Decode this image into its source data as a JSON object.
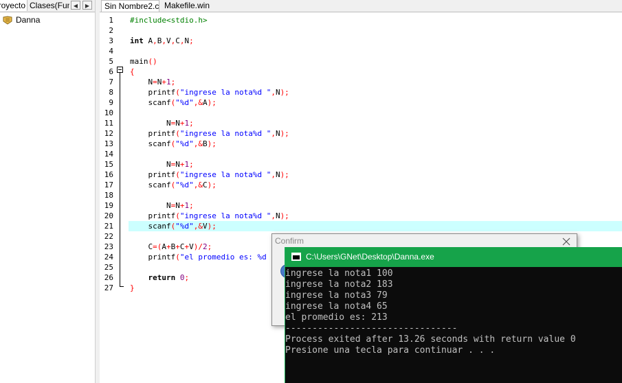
{
  "left_panel": {
    "tabs": [
      "royecto",
      "Clases(Fun"
    ],
    "project_name": "Danna"
  },
  "editor": {
    "tabs": [
      "Sin Nombre2.c",
      "Makefile.win"
    ],
    "highlight_line": 21,
    "lines": [
      [
        [
          "#include<stdio.h>",
          "pre"
        ]
      ],
      [],
      [
        [
          "int",
          "kw"
        ],
        [
          " A",
          ""
        ],
        [
          ",",
          "op"
        ],
        [
          "B",
          ""
        ],
        [
          ",",
          "op"
        ],
        [
          "V",
          ""
        ],
        [
          ",",
          "op"
        ],
        [
          "C",
          ""
        ],
        [
          ",",
          "op"
        ],
        [
          "N",
          ""
        ],
        [
          ";",
          "op"
        ]
      ],
      [],
      [
        [
          "main",
          "fn"
        ],
        [
          "()",
          "op"
        ]
      ],
      [
        [
          "{",
          "op"
        ]
      ],
      [
        [
          "    N",
          "plain"
        ],
        [
          "=",
          "op"
        ],
        [
          "N",
          "plain"
        ],
        [
          "+",
          "op"
        ],
        [
          "1",
          "num"
        ],
        [
          ";",
          "op"
        ]
      ],
      [
        [
          "    printf",
          "plain"
        ],
        [
          "(",
          "op"
        ],
        [
          "\"ingrese la nota%d \"",
          "str"
        ],
        [
          ",",
          "op"
        ],
        [
          "N",
          "plain"
        ],
        [
          ");",
          "op"
        ]
      ],
      [
        [
          "    scanf",
          "plain"
        ],
        [
          "(",
          "op"
        ],
        [
          "\"%d\"",
          "str"
        ],
        [
          ",&",
          "op"
        ],
        [
          "A",
          "plain"
        ],
        [
          ");",
          "op"
        ]
      ],
      [],
      [
        [
          "        N",
          "plain"
        ],
        [
          "=",
          "op"
        ],
        [
          "N",
          "plain"
        ],
        [
          "+",
          "op"
        ],
        [
          "1",
          "num"
        ],
        [
          ";",
          "op"
        ]
      ],
      [
        [
          "    printf",
          "plain"
        ],
        [
          "(",
          "op"
        ],
        [
          "\"ingrese la nota%d \"",
          "str"
        ],
        [
          ",",
          "op"
        ],
        [
          "N",
          "plain"
        ],
        [
          ");",
          "op"
        ]
      ],
      [
        [
          "    scanf",
          "plain"
        ],
        [
          "(",
          "op"
        ],
        [
          "\"%d\"",
          "str"
        ],
        [
          ",&",
          "op"
        ],
        [
          "B",
          "plain"
        ],
        [
          ");",
          "op"
        ]
      ],
      [],
      [
        [
          "        N",
          "plain"
        ],
        [
          "=",
          "op"
        ],
        [
          "N",
          "plain"
        ],
        [
          "+",
          "op"
        ],
        [
          "1",
          "num"
        ],
        [
          ";",
          "op"
        ]
      ],
      [
        [
          "    printf",
          "plain"
        ],
        [
          "(",
          "op"
        ],
        [
          "\"ingrese la nota%d \"",
          "str"
        ],
        [
          ",",
          "op"
        ],
        [
          "N",
          "plain"
        ],
        [
          ");",
          "op"
        ]
      ],
      [
        [
          "    scanf",
          "plain"
        ],
        [
          "(",
          "op"
        ],
        [
          "\"%d\"",
          "str"
        ],
        [
          ",&",
          "op"
        ],
        [
          "C",
          "plain"
        ],
        [
          ");",
          "op"
        ]
      ],
      [],
      [
        [
          "        N",
          "plain"
        ],
        [
          "=",
          "op"
        ],
        [
          "N",
          "plain"
        ],
        [
          "+",
          "op"
        ],
        [
          "1",
          "num"
        ],
        [
          ";",
          "op"
        ]
      ],
      [
        [
          "    printf",
          "plain"
        ],
        [
          "(",
          "op"
        ],
        [
          "\"ingrese la nota%d \"",
          "str"
        ],
        [
          ",",
          "op"
        ],
        [
          "N",
          "plain"
        ],
        [
          ");",
          "op"
        ]
      ],
      [
        [
          "    scanf",
          "plain"
        ],
        [
          "(",
          "op"
        ],
        [
          "\"%d\"",
          "str"
        ],
        [
          ",&",
          "op"
        ],
        [
          "V",
          "plain"
        ],
        [
          ");",
          "op"
        ]
      ],
      [],
      [
        [
          "    C",
          "plain"
        ],
        [
          "=(",
          "op"
        ],
        [
          "A",
          "plain"
        ],
        [
          "+",
          "op"
        ],
        [
          "B",
          "plain"
        ],
        [
          "+",
          "op"
        ],
        [
          "C",
          "plain"
        ],
        [
          "+",
          "op"
        ],
        [
          "V",
          "plain"
        ],
        [
          ")/",
          "op"
        ],
        [
          "2",
          "num"
        ],
        [
          ";",
          "op"
        ]
      ],
      [
        [
          "    printf",
          "plain"
        ],
        [
          "(",
          "op"
        ],
        [
          "\"el promedio es: %d",
          "str"
        ]
      ],
      [],
      [
        [
          "    ",
          "plain"
        ],
        [
          "return",
          "kw"
        ],
        [
          " ",
          "plain"
        ],
        [
          "0",
          "num"
        ],
        [
          ";",
          "op"
        ]
      ],
      [
        [
          "}",
          "op"
        ]
      ]
    ]
  },
  "confirm_dialog": {
    "title": "Confirm"
  },
  "console": {
    "title": "C:\\Users\\GNet\\Desktop\\Danna.exe",
    "output": [
      "ingrese la nota1 100",
      "ingrese la nota2 183",
      "ingrese la nota3 79",
      "ingrese la nota4 65",
      "el promedio es: 213",
      "--------------------------------",
      "Process exited after 13.26 seconds with return value 0",
      "Presione una tecla para continuar . . ."
    ]
  },
  "colors": {
    "console_titlebar": "#16a34a",
    "line_highlight": "#ccffff",
    "string": "#0000ff",
    "operator": "#ff0000",
    "number": "#800080",
    "preprocessor": "#008000"
  }
}
